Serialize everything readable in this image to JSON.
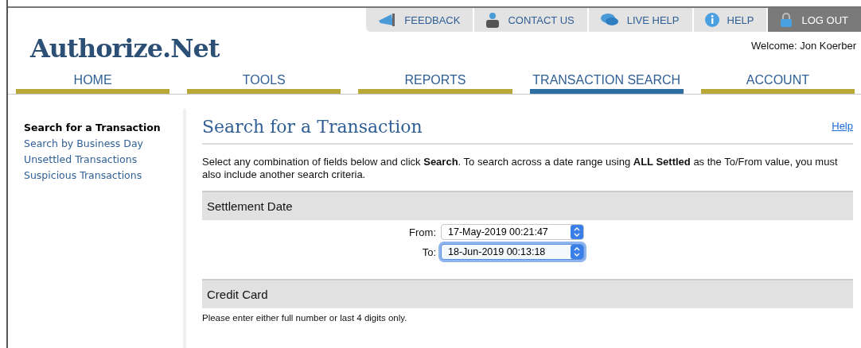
{
  "utility_tabs": [
    {
      "label": "FEEDBACK",
      "highlighted": false
    },
    {
      "label": "CONTACT US",
      "highlighted": false
    },
    {
      "label": "LIVE HELP",
      "highlighted": false
    },
    {
      "label": "HELP",
      "highlighted": false
    },
    {
      "label": "LOG OUT",
      "highlighted": true
    }
  ],
  "logo": "Authorize.Net",
  "welcome": "Welcome: Jon Koerber",
  "nav": [
    {
      "label": "HOME",
      "selected": false
    },
    {
      "label": "TOOLS",
      "selected": false
    },
    {
      "label": "REPORTS",
      "selected": false
    },
    {
      "label": "TRANSACTION SEARCH",
      "selected": true
    },
    {
      "label": "ACCOUNT",
      "selected": false
    }
  ],
  "sidebar": {
    "items": [
      {
        "label": "Search for a Transaction",
        "selected": true
      },
      {
        "label": "Search by Business Day",
        "selected": false
      },
      {
        "label": "Unsettled Transactions",
        "selected": false
      },
      {
        "label": "Suspicious Transactions",
        "selected": false
      }
    ]
  },
  "page": {
    "title": "Search for a Transaction",
    "help_link": "Help",
    "intro": "Select any combination of fields below and click **Search**. To search across a date range using **ALL Settled** as the To/From value, you must also include another search criteria."
  },
  "sections": [
    {
      "title": "Settlement Date",
      "fields": [
        {
          "label": "From:",
          "value": "17-May-2019 00:21:47",
          "focused": false
        },
        {
          "label": "To:",
          "value": "18-Jun-2019 00:13:18",
          "focused": true
        }
      ]
    },
    {
      "title": "Credit Card",
      "hint": "Please enter either full number or last 4 digits only."
    }
  ]
}
